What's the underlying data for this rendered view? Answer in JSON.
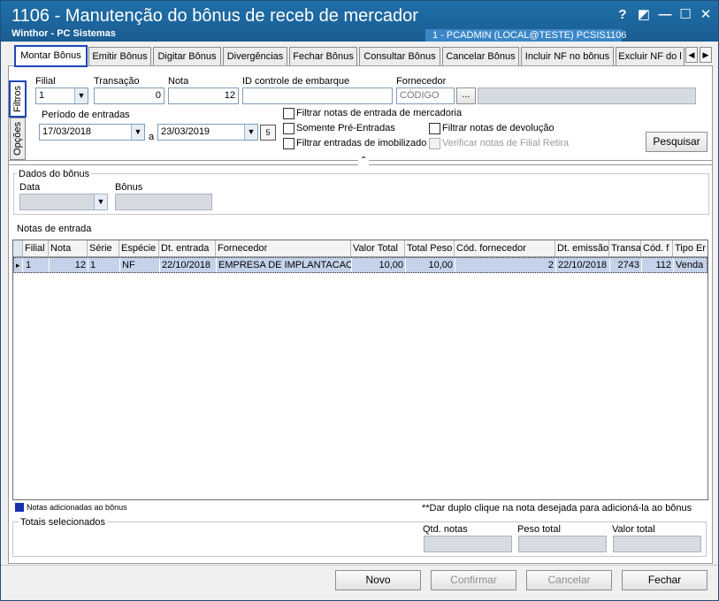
{
  "window": {
    "title": "1106 - Manutenção do bônus de receb de mercador",
    "subtitle": "Winthor - PC Sistemas",
    "user_info": "1 - PCADMIN (LOCAL@TESTE)  PCSIS1106",
    "buttons": {
      "help": "?",
      "restore": "◩",
      "minimize": "—",
      "maximize": "☐",
      "close": "✕"
    }
  },
  "tabs": [
    {
      "label": "Montar Bônus",
      "active": true
    },
    {
      "label": "Emitir Bônus"
    },
    {
      "label": "Digitar Bônus"
    },
    {
      "label": "Divergências"
    },
    {
      "label": "Fechar Bônus"
    },
    {
      "label": "Consultar Bônus"
    },
    {
      "label": "Cancelar Bônus"
    },
    {
      "label": "Incluir NF no bônus"
    },
    {
      "label": "Excluir NF do l"
    }
  ],
  "side_tabs": {
    "filtros": "Filtros",
    "opcoes": "Opções"
  },
  "filters": {
    "filial_label": "Filial",
    "filial_value": "1",
    "transacao_label": "Transação",
    "transacao_value": "0",
    "nota_label": "Nota",
    "nota_value": "12",
    "id_embarque_label": "ID controle de embarque",
    "id_embarque_value": "",
    "fornecedor_label": "Fornecedor",
    "fornecedor_code_placeholder": "CÓDIGO",
    "fornecedor_lookup_button": "...",
    "periodo_label": "Período de entradas",
    "data_inicio": "17/03/2018",
    "data_separator": "a",
    "data_fim": "23/03/2019",
    "calendar_icon_text": "5",
    "check_filtrar_entrada": "Filtrar notas de entrada de mercadoria",
    "check_somente_pre": "Somente Pré-Entradas",
    "check_filtrar_devolucao": "Filtrar notas de devolução",
    "check_filtrar_imobilizado": "Filtrar entradas de imobilizado",
    "check_verificar_filial": "Verificar notas de Filial Retira",
    "pesquisar_button": "Pesquisar"
  },
  "dados_bonus": {
    "title": "Dados do bônus",
    "data_label": "Data",
    "bonus_label": "Bônus"
  },
  "notas": {
    "title": "Notas de entrada",
    "columns": [
      "Filial",
      "Nota",
      "Série",
      "Espécie",
      "Dt. entrada",
      "Fornecedor",
      "Valor Total",
      "Total Peso",
      "Cód. fornecedor",
      "Dt. emissão",
      "Transa",
      "Cód. f",
      "Tipo Er"
    ],
    "rows": [
      [
        "1",
        "12",
        "1",
        "NF",
        "22/10/2018",
        "EMPRESA DE IMPLANTACAO LT",
        "10,00",
        "10,00",
        "2",
        "22/10/2018",
        "2743",
        "112",
        "Venda"
      ]
    ]
  },
  "legend": {
    "color": "#1a2fb0",
    "text": "Notas adicionadas ao bônus",
    "hint": "**Dar duplo clique na nota desejada para adicioná-la ao bônus"
  },
  "totais": {
    "title": "Totais selecionados",
    "qtd_label": "Qtd. notas",
    "peso_label": "Peso total",
    "valor_label": "Valor total"
  },
  "actions": {
    "novo": "Novo",
    "confirmar": "Confirmar",
    "cancelar": "Cancelar",
    "fechar": "Fechar"
  }
}
